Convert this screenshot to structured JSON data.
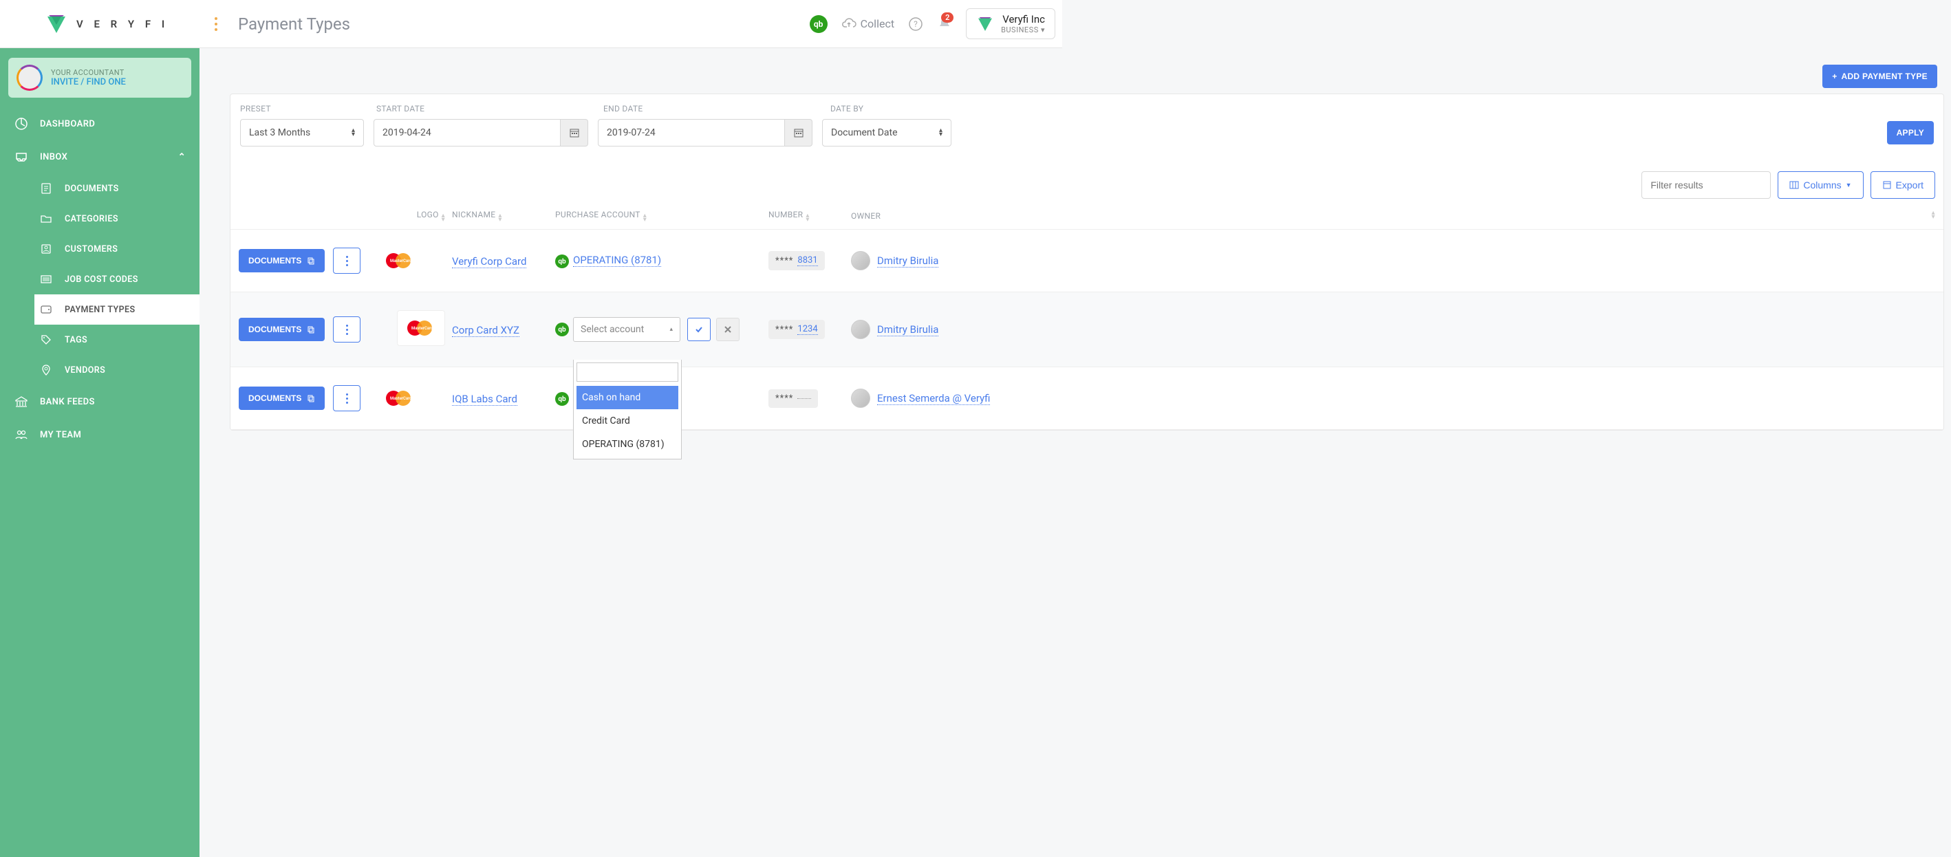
{
  "header": {
    "brand": "V E R Y F I",
    "page_title": "Payment Types",
    "collect": "Collect",
    "notifications": "2",
    "account_name": "Veryfi Inc",
    "account_type": "BUSINESS"
  },
  "accountant": {
    "label": "YOUR ACCOUNTANT",
    "action": "INVITE / FIND ONE"
  },
  "sidebar": {
    "dashboard": "DASHBOARD",
    "inbox": "INBOX",
    "documents": "DOCUMENTS",
    "categories": "CATEGORIES",
    "customers": "CUSTOMERS",
    "job_cost": "JOB COST CODES",
    "payment_types": "PAYMENT TYPES",
    "tags": "TAGS",
    "vendors": "VENDORS",
    "bank_feeds": "BANK FEEDS",
    "my_team": "MY TEAM"
  },
  "buttons": {
    "add_payment": "ADD PAYMENT TYPE",
    "apply": "APPLY",
    "columns": "Columns",
    "export": "Export",
    "documents": "DOCUMENTS"
  },
  "filters": {
    "labels": {
      "preset": "PRESET",
      "start": "START DATE",
      "end": "END DATE",
      "dateby": "DATE BY"
    },
    "preset": "Last 3 Months",
    "start_date": "2019-04-24",
    "end_date": "2019-07-24",
    "date_by": "Document Date",
    "filter_placeholder": "Filter results"
  },
  "columns": {
    "logo": "LOGO",
    "nickname": "NICKNAME",
    "purchase_account": "PURCHASE ACCOUNT",
    "number": "NUMBER",
    "owner": "OWNER"
  },
  "rows": [
    {
      "nickname": "Veryfi Corp Card",
      "account": "OPERATING (8781)",
      "number_mask": "****",
      "number": "8831",
      "owner": "Dmitry Birulia"
    },
    {
      "nickname": "Corp Card XYZ",
      "account_placeholder": "Select account",
      "number_mask": "****",
      "number": "1234",
      "owner": "Dmitry Birulia"
    },
    {
      "nickname": "IQB Labs Card",
      "number_mask": "****",
      "number": "",
      "owner": "Ernest Semerda @ Veryfi"
    }
  ],
  "dropdown": {
    "search": "",
    "options": [
      "Cash on hand",
      "Credit Card",
      "OPERATING (8781)"
    ]
  },
  "colors": {
    "primary": "#4a7deb",
    "sidebar": "#5fb98a",
    "qb": "#2ca01c"
  }
}
